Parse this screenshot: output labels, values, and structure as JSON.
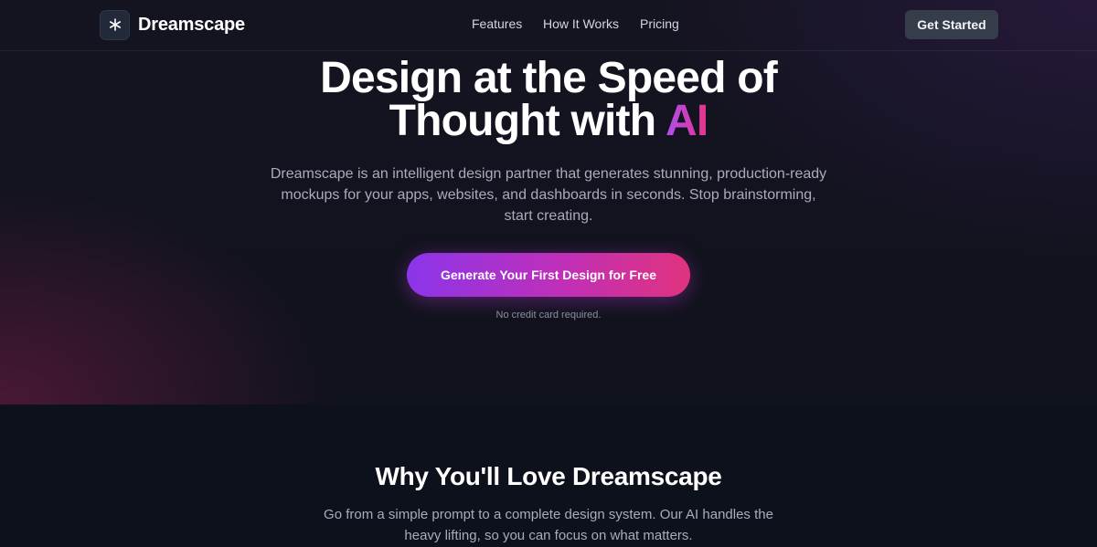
{
  "brand": {
    "name": "Dreamscape",
    "logo_icon": "sparkle-icon"
  },
  "nav": {
    "links": [
      "Features",
      "How It Works",
      "Pricing"
    ],
    "cta_label": "Get Started"
  },
  "hero": {
    "headline_line1": "Design at the Speed of",
    "headline_line2_prefix": "Thought with ",
    "headline_accent": "AI",
    "subtext": "Dreamscape is an intelligent design partner that generates stunning, production-ready mockups for your apps, websites, and dashboards in seconds. Stop brainstorming, start creating.",
    "cta_label": "Generate Your First Design for Free",
    "note": "No credit card required."
  },
  "features": {
    "title": "Why You'll Love Dreamscape",
    "description": "Go from a simple prompt to a complete design system. Our AI handles the heavy lifting, so you can focus on what matters."
  },
  "colors": {
    "background": "#0d111c",
    "accent_start": "#8b35ea",
    "accent_end": "#e0337d",
    "button_secondary": "#353d4b"
  }
}
